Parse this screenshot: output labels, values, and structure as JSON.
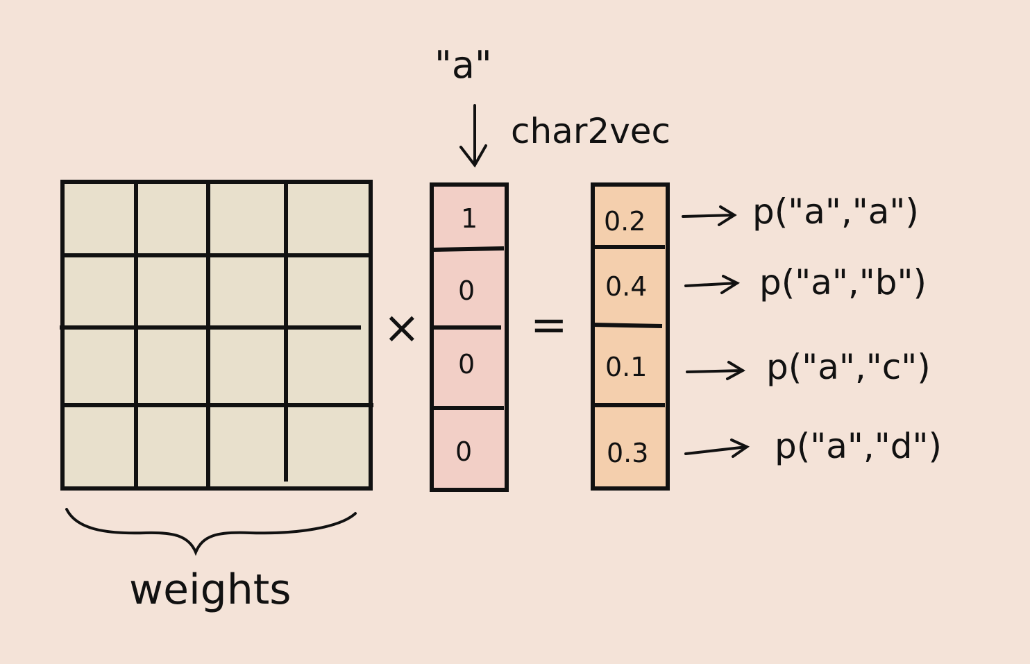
{
  "diagram": {
    "input_char": "\"a\"",
    "function_label": "char2vec",
    "weights_label": "weights",
    "weights_grid": {
      "rows": 4,
      "cols": 4
    },
    "times_symbol": "×",
    "equals_symbol": "=",
    "input_vector": [
      "1",
      "0",
      "0",
      "0"
    ],
    "output_vector": [
      "0.2",
      "0.4",
      "0.1",
      "0.3"
    ],
    "output_labels": [
      "p(\"a\",\"a\")",
      "p(\"a\",\"b\")",
      "p(\"a\",\"c\")",
      "p(\"a\",\"d\")"
    ]
  },
  "colors": {
    "background": "#f4e3d8",
    "weights_fill": "#e8e0cc",
    "input_vector_fill": "#f2cfc6",
    "output_vector_fill": "#f4cfad",
    "ink": "#111111"
  }
}
